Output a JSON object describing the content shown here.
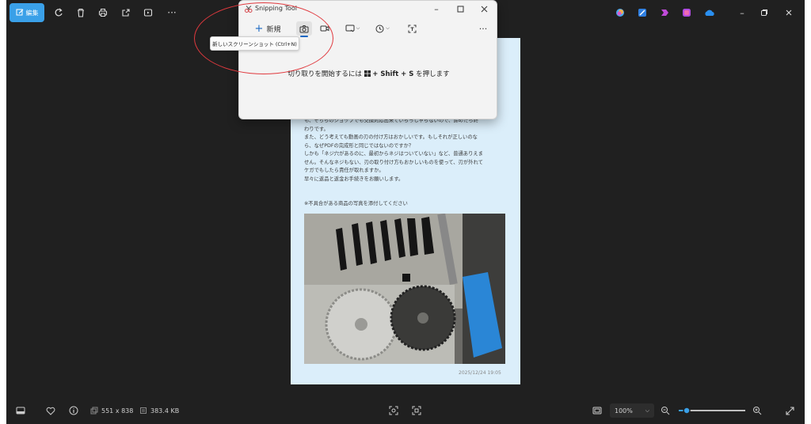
{
  "toolbar": {
    "edit_label": "編集"
  },
  "snipping": {
    "title": "Snipping Tool",
    "new_label": "新規",
    "hint_prefix": "切り取りを開始するには",
    "hint_keys": "+ Shift + S",
    "hint_suffix": "を押します",
    "tooltip": "新しいスクリーンショット (Ctrl+N)"
  },
  "photo": {
    "lines": [
      "も、そちらのショップでも交換対応出来ていらっしゃらないので、諦めたら終",
      "わりです。",
      "また、どう考えても動画の刃の付け方はおかしいです。もしそれが正しいのな",
      "ら、なぜPDFの完成形と同じではないのですか？",
      "しかも「ネジ穴があるのに、最初からネジはついていない」など、普通ありえま",
      "せん。そんなネジもない、刃の取り付け方もおかしいものを使って、刃が外れて",
      "ケガでもしたら責任が取れますか。",
      "早々に返品と返金お手続きをお願いします。"
    ],
    "note": "※不具合がある商品の写真を添付してください",
    "timestamp": "2025/12/24 19:05"
  },
  "status": {
    "dimensions": "551 x 838",
    "filesize": "383.4 KB",
    "zoom": "100%",
    "zoom_level": 0.12
  },
  "colors": {
    "accent": "#3aa0e8",
    "annotation": "#e0393e"
  }
}
